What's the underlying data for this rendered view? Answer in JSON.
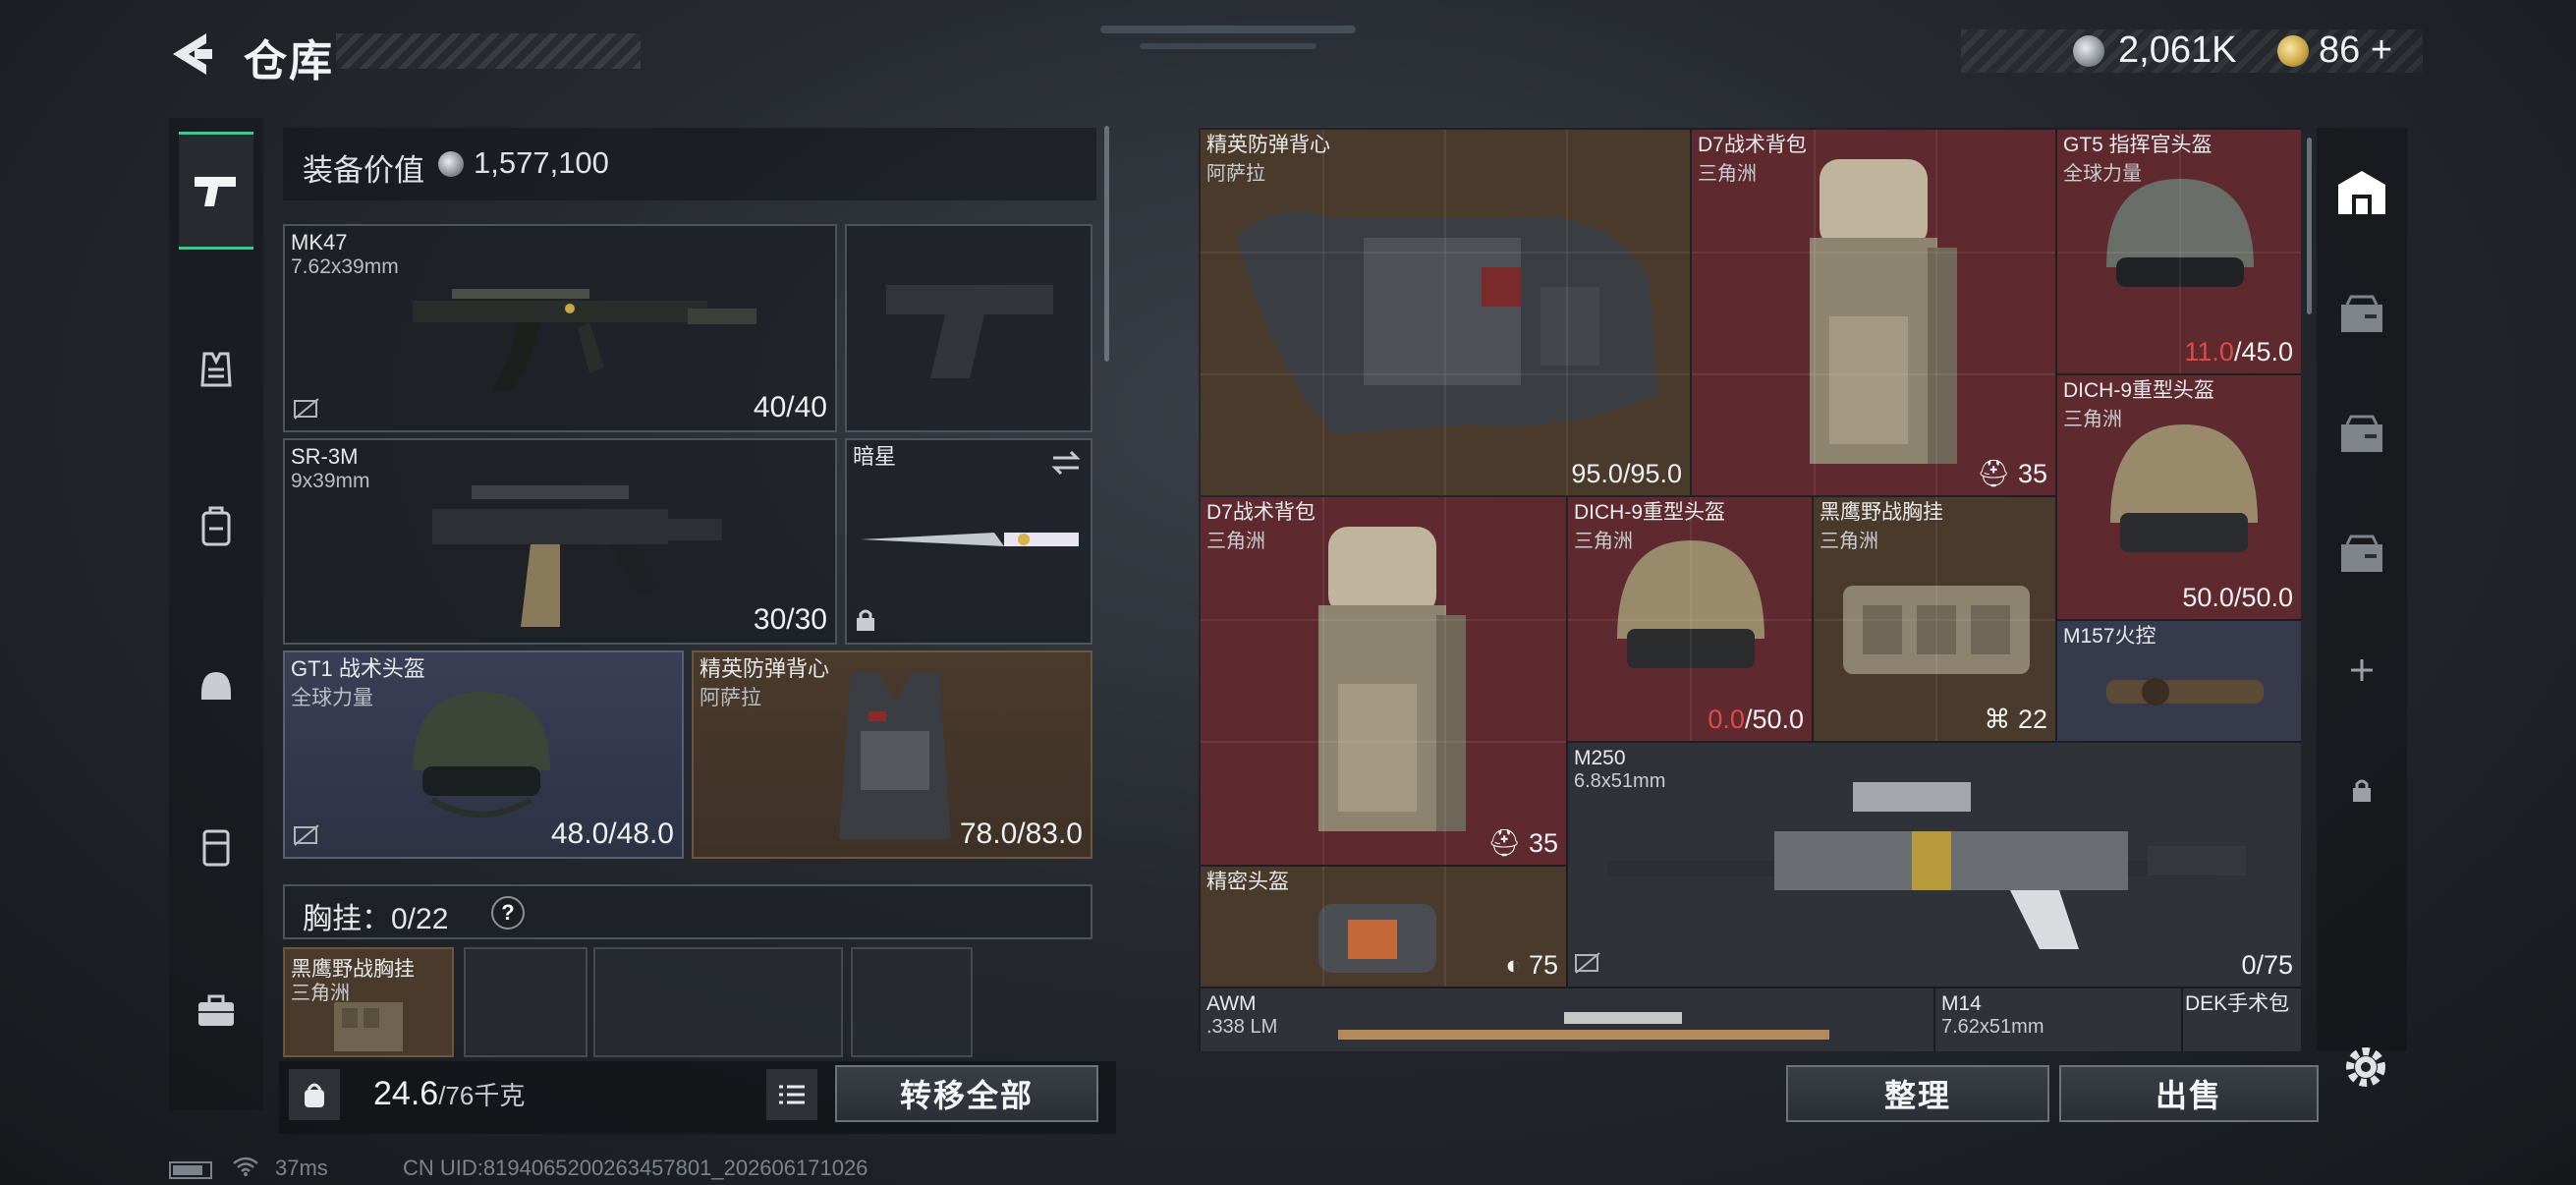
{
  "header": {
    "title": "仓库",
    "currency_silver": "2,061K",
    "currency_gold": "86",
    "currency_add": "+"
  },
  "left_panel": {
    "equip_value_label": "装备价值",
    "equip_value": "1,577,100",
    "slots": {
      "primary1": {
        "name": "MK47",
        "caliber": "7.62x39mm",
        "ammo": "40/40"
      },
      "primary2": {
        "name": "SR-3M",
        "caliber": "9x39mm",
        "ammo": "30/30"
      },
      "melee": {
        "name": "暗星"
      },
      "helmet": {
        "name": "GT1 战术头盔",
        "brand": "全球力量",
        "durability": "48.0/48.0"
      },
      "armor": {
        "name": "精英防弹背心",
        "brand": "阿萨拉",
        "durability": "78.0/83.0"
      }
    },
    "chest_label": "胸挂：0/22",
    "chest_help": "?",
    "chest_item": {
      "name": "黑鹰野战胸挂",
      "brand": "三角洲"
    },
    "weight": "24.6",
    "weight_unit": "/76千克",
    "transfer_all": "转移全部"
  },
  "storage": {
    "items": [
      {
        "id": "vest",
        "name": "精英防弹背心",
        "brand": "阿萨拉",
        "value": "95.0/95.0"
      },
      {
        "id": "bag1",
        "name": "D7战术背包",
        "brand": "三角洲",
        "value": "35"
      },
      {
        "id": "gt5",
        "name": "GT5 指挥官头盔",
        "brand": "全球力量",
        "value_low": "11.0",
        "value_rest": "/45.0"
      },
      {
        "id": "dich1",
        "name": "DICH-9重型头盔",
        "brand": "三角洲",
        "value": "50.0/50.0"
      },
      {
        "id": "bag2",
        "name": "D7战术背包",
        "brand": "三角洲",
        "value": "35"
      },
      {
        "id": "dich2",
        "name": "DICH-9重型头盔",
        "brand": "三角洲",
        "value_low": "0.0",
        "value_rest": "/50.0"
      },
      {
        "id": "chest",
        "name": "黑鹰野战胸挂",
        "brand": "三角洲",
        "value": "22"
      },
      {
        "id": "m157",
        "name": "M157火控"
      },
      {
        "id": "m250",
        "name": "M250",
        "brand": "6.8x51mm",
        "value": "0/75"
      },
      {
        "id": "precise",
        "name": "精密头盔",
        "value": "75"
      },
      {
        "id": "awm",
        "name": "AWM",
        "brand": ".338 LM"
      },
      {
        "id": "m14",
        "name": "M14",
        "brand": "7.62x51mm"
      },
      {
        "id": "dek",
        "name": "DEK手术包"
      }
    ],
    "sort_button": "整理",
    "sell_button": "出售"
  },
  "status_bar": {
    "ping": "37ms",
    "uid": "CN UID:8194065200263457801_202606171026"
  },
  "colors": {
    "accent_green": "#2fd08c",
    "rare_red": "#5e2a30",
    "low_durability": "#e14a44"
  }
}
